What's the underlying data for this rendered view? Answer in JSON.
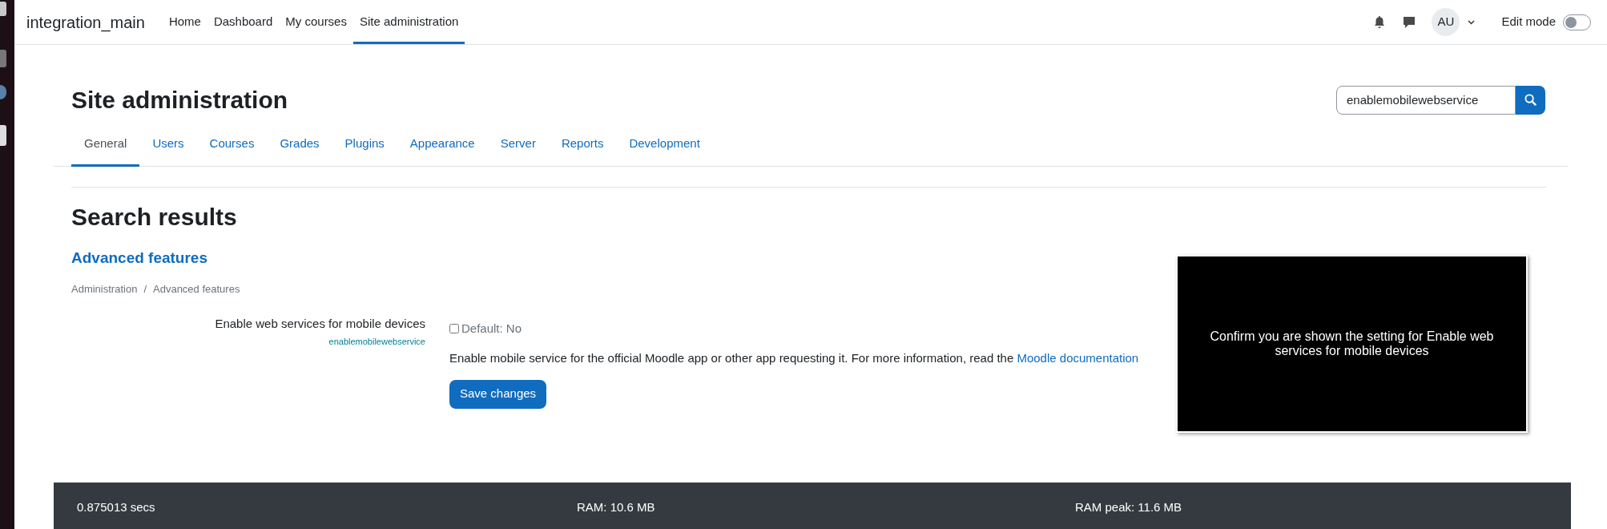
{
  "navbar": {
    "brand": "integration_main",
    "items": [
      {
        "label": "Home",
        "selected": false
      },
      {
        "label": "Dashboard",
        "selected": false
      },
      {
        "label": "My courses",
        "selected": false
      },
      {
        "label": "Site administration",
        "selected": true
      }
    ],
    "avatar": "AU",
    "edit_mode": {
      "label": "Edit mode",
      "on": false
    }
  },
  "page": {
    "title": "Site administration",
    "search": {
      "value": "enablemobilewebservice"
    },
    "tabs": [
      {
        "label": "General",
        "selected": true
      },
      {
        "label": "Users",
        "selected": false
      },
      {
        "label": "Courses",
        "selected": false
      },
      {
        "label": "Grades",
        "selected": false
      },
      {
        "label": "Plugins",
        "selected": false
      },
      {
        "label": "Appearance",
        "selected": false
      },
      {
        "label": "Server",
        "selected": false
      },
      {
        "label": "Reports",
        "selected": false
      },
      {
        "label": "Development",
        "selected": false
      }
    ]
  },
  "results": {
    "heading": "Search results",
    "section": "Advanced features",
    "breadcrumb": [
      "Administration",
      "Advanced features"
    ],
    "breadcrumb_separator": "/",
    "setting": {
      "label": "Enable web services for mobile devices",
      "name": "enablemobilewebservice",
      "checked": false,
      "default": "Default: No",
      "description": "Enable mobile service for the official Moodle app or other app requesting it. For more information, read the",
      "link": "Moodle documentation"
    },
    "save_button": "Save changes"
  },
  "overlay": {
    "text": "Confirm you are shown the setting for Enable web services for mobile devices"
  },
  "footer": [
    "0.875013 secs",
    "RAM: 10.6 MB",
    "RAM peak: 11.6 MB"
  ]
}
